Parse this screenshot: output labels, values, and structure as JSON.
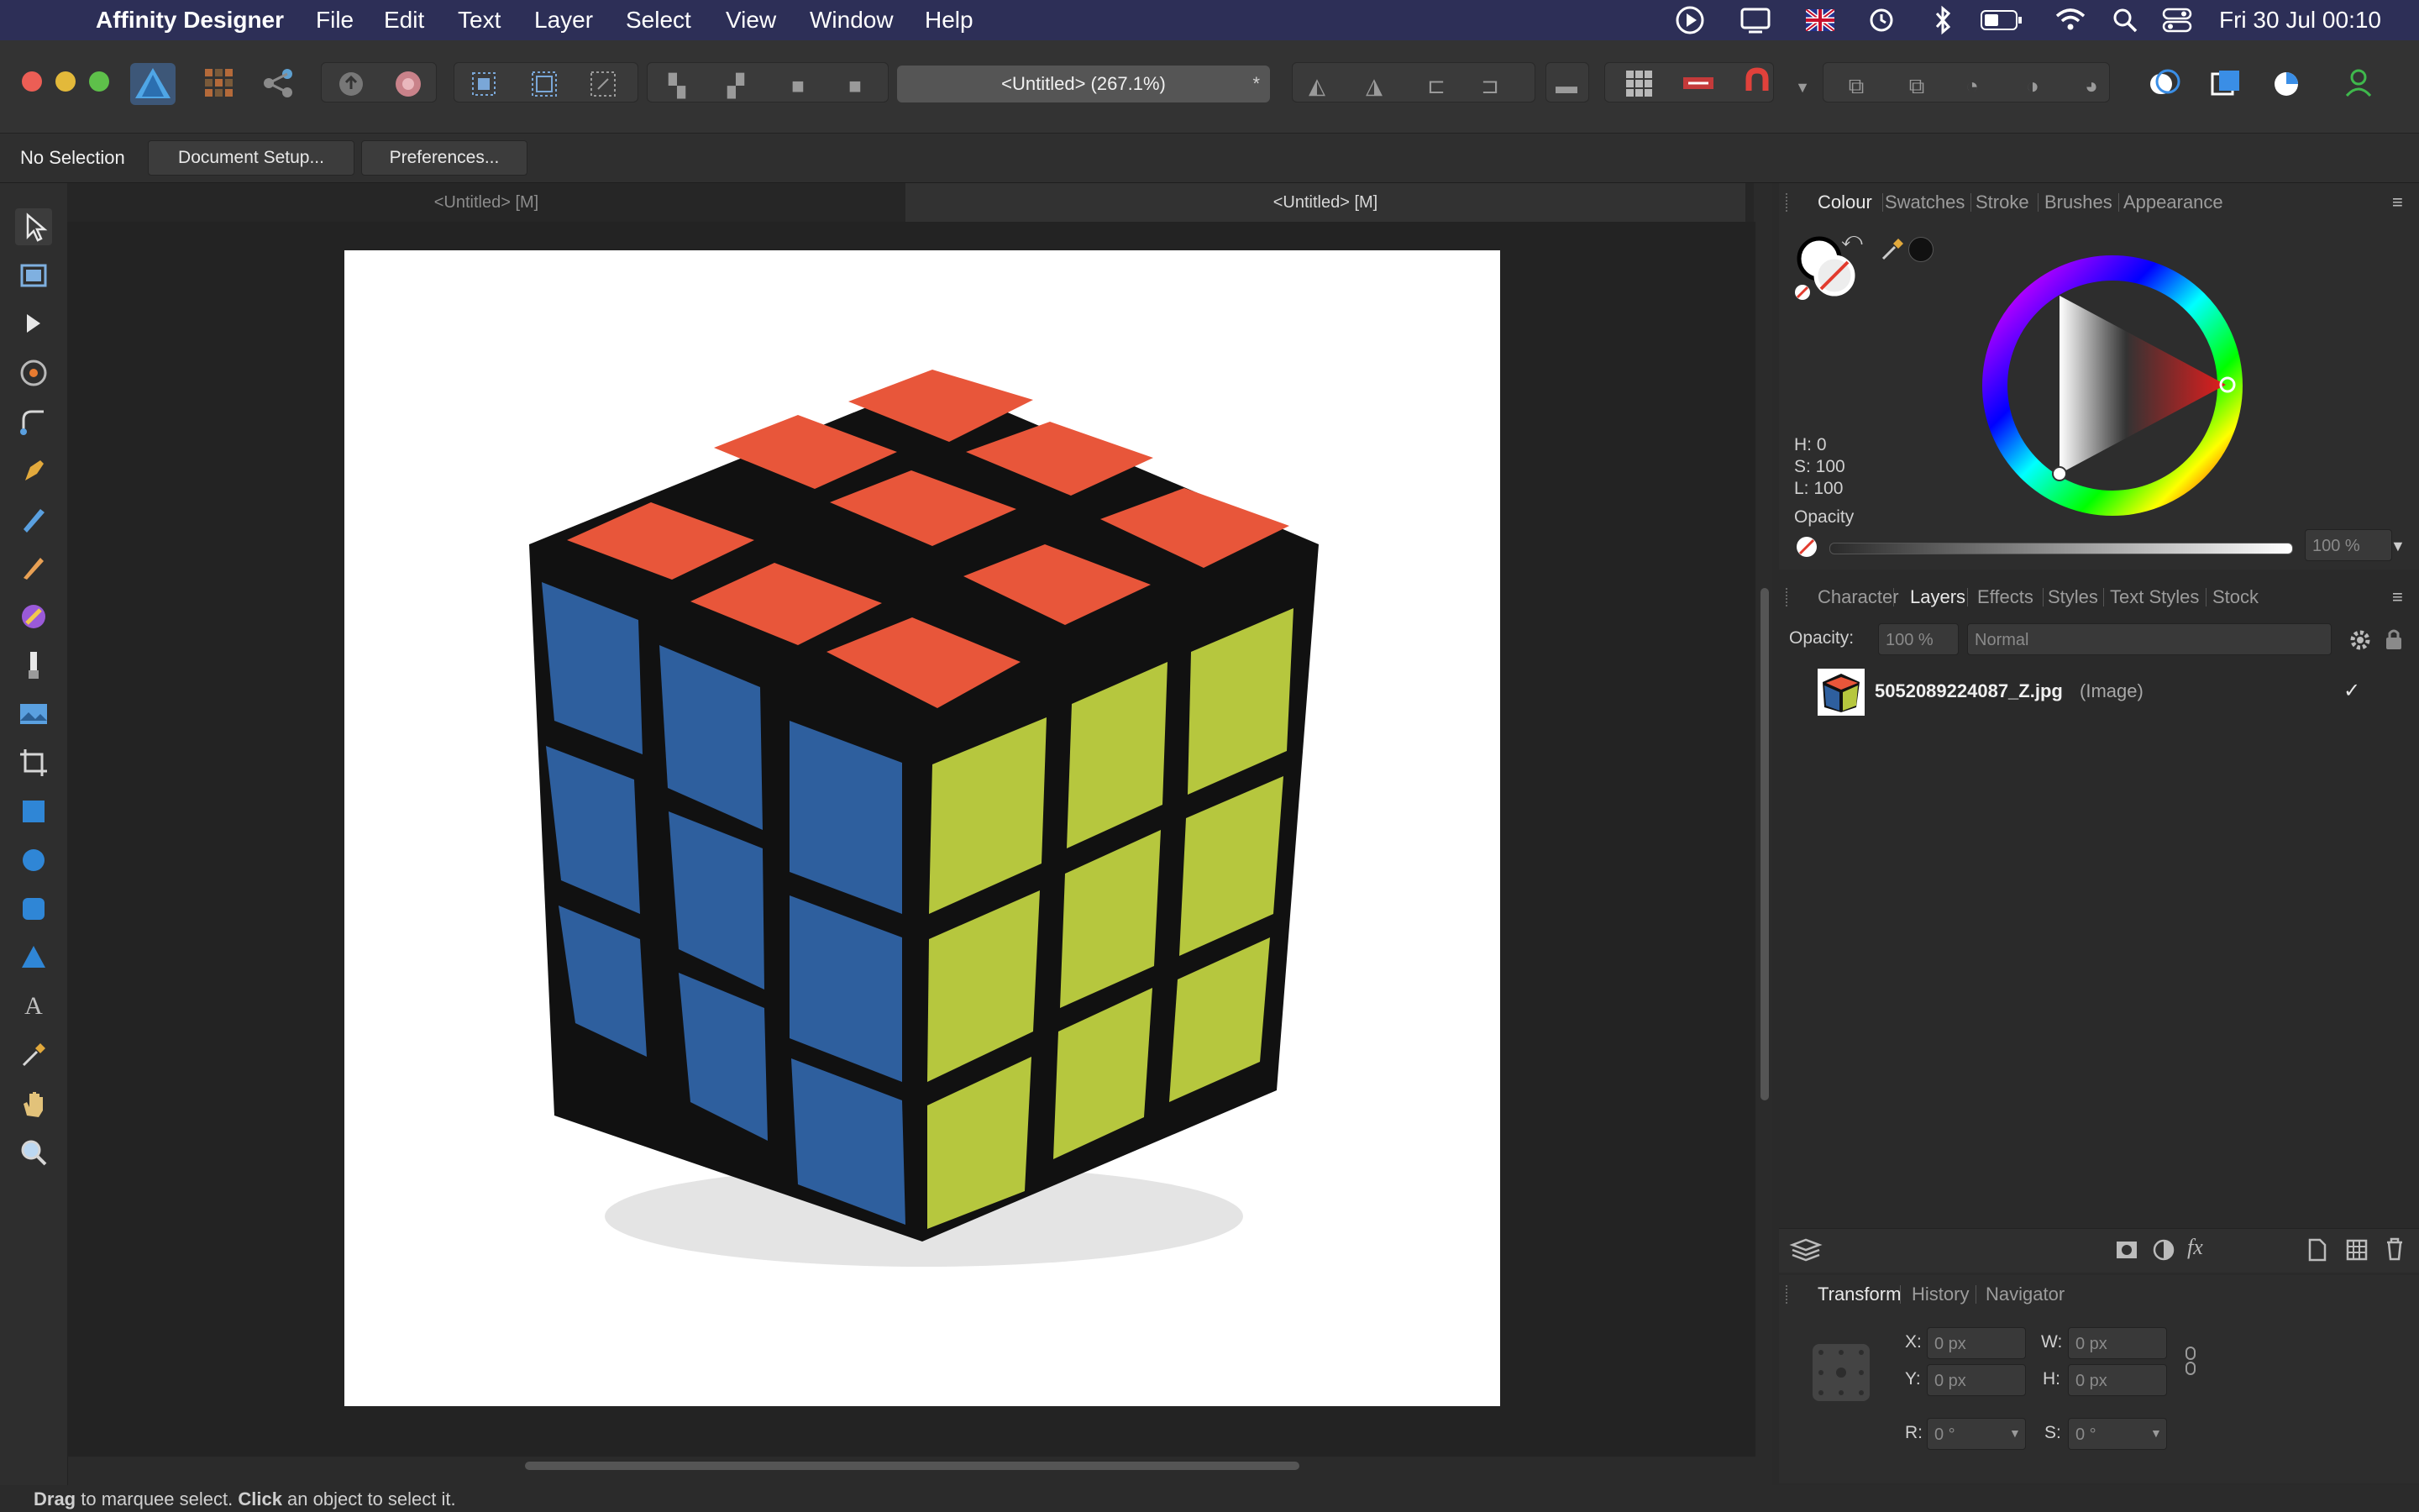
{
  "menubar": {
    "app": "Affinity Designer",
    "items": [
      "File",
      "Edit",
      "Text",
      "Layer",
      "Select",
      "View",
      "Window",
      "Help"
    ],
    "datetime": "Fri 30 Jul  00:10"
  },
  "toolbar": {
    "document_title": "<Untitled> (267.1%)",
    "modified_marker": "*"
  },
  "context": {
    "selection": "No Selection",
    "document_setup": "Document Setup...",
    "preferences": "Preferences..."
  },
  "tabs": {
    "left": "<Untitled> [M]",
    "right": "<Untitled> [M]"
  },
  "colour_panel": {
    "tabs": [
      "Colour",
      "Swatches",
      "Stroke",
      "Brushes",
      "Appearance"
    ],
    "h": "H: 0",
    "s": "S: 100",
    "l": "L: 100",
    "opacity_label": "Opacity",
    "opacity_value": "100 %"
  },
  "layers_panel": {
    "tabs": [
      "Character",
      "Layers",
      "Effects",
      "Styles",
      "Text Styles",
      "Stock"
    ],
    "opacity_label": "Opacity:",
    "opacity_value": "100 %",
    "blend_mode": "Normal",
    "layer_name": "5052089224087_Z.jpg",
    "layer_type": "(Image)",
    "visible_check": "✓"
  },
  "transform_panel": {
    "tabs": [
      "Transform",
      "History",
      "Navigator"
    ],
    "x_label": "X:",
    "x_value": "0 px",
    "y_label": "Y:",
    "y_value": "0 px",
    "w_label": "W:",
    "w_value": "0 px",
    "h_label": "H:",
    "h_value": "0 px",
    "r_label": "R:",
    "r_value": "0 °",
    "s_label": "S:",
    "s_value": "0 °"
  },
  "status": {
    "drag": "Drag",
    "drag_text": " to marquee select. ",
    "click": "Click",
    "click_text": " an object to select it."
  },
  "colors": {
    "accent": "#2f80d0",
    "red_face": "#e8563a",
    "blue_face": "#2e5f9e",
    "yellow_face": "#b6c73e"
  }
}
